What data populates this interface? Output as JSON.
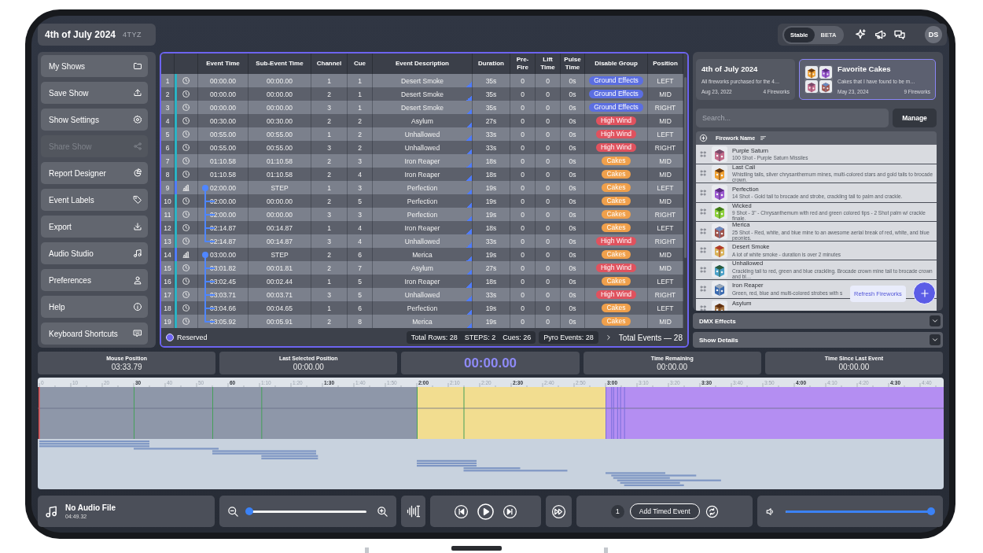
{
  "show": {
    "title": "4th of July 2024",
    "code": "4TYZ"
  },
  "release_toggle": [
    {
      "label": "Stable",
      "selected": true
    },
    {
      "label": "BETA",
      "selected": false
    }
  ],
  "user": {
    "initials": "DS"
  },
  "sidebar": {
    "items": [
      {
        "label": "My Shows",
        "disabled": false
      },
      {
        "label": "Save Show",
        "disabled": false
      },
      {
        "label": "Show Settings",
        "disabled": false
      },
      {
        "label": "Share Show",
        "disabled": true
      },
      {
        "label": "Report Designer",
        "disabled": false
      },
      {
        "label": "Event Labels",
        "disabled": false
      },
      {
        "label": "Export",
        "disabled": false
      },
      {
        "label": "Audio Studio",
        "disabled": false
      },
      {
        "label": "Preferences",
        "disabled": false
      },
      {
        "label": "Help",
        "disabled": false
      },
      {
        "label": "Keyboard Shortcuts",
        "disabled": false
      }
    ]
  },
  "table": {
    "columns": [
      "Event Time",
      "Sub-Event Time",
      "Channel",
      "Cue",
      "Event Description",
      "Duration",
      "Pre-Fire",
      "Lift Time",
      "Pulse Time",
      "Disable Group",
      "Position"
    ],
    "rows": [
      {
        "number": "1",
        "kind": "timed",
        "event_time": "00:00.00",
        "sub_event_time": "00:00.00",
        "channel": "1",
        "cue": "1",
        "description": "Desert Smoke",
        "duration": "35s",
        "pre_fire": "0",
        "lift_time": "0",
        "pulse_time": "0s",
        "disable_group": {
          "label": "Ground Effects",
          "color": "#5b6ee1"
        },
        "position": "LEFT"
      },
      {
        "number": "2",
        "kind": "timed",
        "event_time": "00:00.00",
        "sub_event_time": "00:00.00",
        "channel": "2",
        "cue": "1",
        "description": "Desert Smoke",
        "duration": "35s",
        "pre_fire": "0",
        "lift_time": "0",
        "pulse_time": "0s",
        "disable_group": {
          "label": "Ground Effects",
          "color": "#5b6ee1"
        },
        "position": "MID"
      },
      {
        "number": "3",
        "kind": "timed",
        "event_time": "00:00.00",
        "sub_event_time": "00:00.00",
        "channel": "3",
        "cue": "1",
        "description": "Desert Smoke",
        "duration": "35s",
        "pre_fire": "0",
        "lift_time": "0",
        "pulse_time": "0s",
        "disable_group": {
          "label": "Ground Effects",
          "color": "#5b6ee1"
        },
        "position": "RIGHT"
      },
      {
        "number": "4",
        "kind": "timed",
        "event_time": "00:30.00",
        "sub_event_time": "00:30.00",
        "channel": "2",
        "cue": "2",
        "description": "Asylum",
        "duration": "27s",
        "pre_fire": "0",
        "lift_time": "0",
        "pulse_time": "0s",
        "disable_group": {
          "label": "High Wind",
          "color": "#e0525e"
        },
        "position": "MID"
      },
      {
        "number": "5",
        "kind": "timed",
        "event_time": "00:55.00",
        "sub_event_time": "00:55.00",
        "channel": "1",
        "cue": "2",
        "description": "Unhallowed",
        "duration": "33s",
        "pre_fire": "0",
        "lift_time": "0",
        "pulse_time": "0s",
        "disable_group": {
          "label": "High Wind",
          "color": "#e0525e"
        },
        "position": "LEFT"
      },
      {
        "number": "6",
        "kind": "timed",
        "event_time": "00:55.00",
        "sub_event_time": "00:55.00",
        "channel": "3",
        "cue": "2",
        "description": "Unhallowed",
        "duration": "33s",
        "pre_fire": "0",
        "lift_time": "0",
        "pulse_time": "0s",
        "disable_group": {
          "label": "High Wind",
          "color": "#e0525e"
        },
        "position": "RIGHT"
      },
      {
        "number": "7",
        "kind": "timed",
        "event_time": "01:10.58",
        "sub_event_time": "01:10.58",
        "channel": "2",
        "cue": "3",
        "description": "Iron Reaper",
        "duration": "18s",
        "pre_fire": "0",
        "lift_time": "0",
        "pulse_time": "0s",
        "disable_group": {
          "label": "Cakes",
          "color": "#f0a04b"
        },
        "position": "MID"
      },
      {
        "number": "8",
        "kind": "timed",
        "event_time": "01:10.58",
        "sub_event_time": "01:10.58",
        "channel": "2",
        "cue": "4",
        "description": "Iron Reaper",
        "duration": "18s",
        "pre_fire": "0",
        "lift_time": "0",
        "pulse_time": "0s",
        "disable_group": {
          "label": "Cakes",
          "color": "#f0a04b"
        },
        "position": "MID"
      },
      {
        "number": "9",
        "kind": "step",
        "event_time": "02:00.00",
        "sub_event_time": "STEP",
        "channel": "1",
        "cue": "3",
        "description": "Perfection",
        "duration": "19s",
        "pre_fire": "0",
        "lift_time": "0",
        "pulse_time": "0s",
        "disable_group": {
          "label": "Cakes",
          "color": "#f0a04b"
        },
        "position": "LEFT",
        "children": [
          {
            "number": "10",
            "kind": "timed",
            "event_time": "02:00.00",
            "sub_event_time": "00:00.00",
            "channel": "2",
            "cue": "5",
            "description": "Perfection",
            "duration": "19s",
            "pre_fire": "0",
            "lift_time": "0",
            "pulse_time": "0s",
            "disable_group": {
              "label": "Cakes",
              "color": "#f0a04b"
            },
            "position": "MID"
          },
          {
            "number": "11",
            "kind": "timed",
            "event_time": "02:00.00",
            "sub_event_time": "00:00.00",
            "channel": "3",
            "cue": "3",
            "description": "Perfection",
            "duration": "19s",
            "pre_fire": "0",
            "lift_time": "0",
            "pulse_time": "0s",
            "disable_group": {
              "label": "Cakes",
              "color": "#f0a04b"
            },
            "position": "RIGHT"
          },
          {
            "number": "12",
            "kind": "timed",
            "event_time": "02:14.87",
            "sub_event_time": "00:14.87",
            "channel": "1",
            "cue": "4",
            "description": "Iron Reaper",
            "duration": "18s",
            "pre_fire": "0",
            "lift_time": "0",
            "pulse_time": "0s",
            "disable_group": {
              "label": "Cakes",
              "color": "#f0a04b"
            },
            "position": "LEFT"
          },
          {
            "number": "13",
            "kind": "timed",
            "event_time": "02:14.87",
            "sub_event_time": "00:14.87",
            "channel": "3",
            "cue": "4",
            "description": "Unhallowed",
            "duration": "33s",
            "pre_fire": "0",
            "lift_time": "0",
            "pulse_time": "0s",
            "disable_group": {
              "label": "High Wind",
              "color": "#e0525e"
            },
            "position": "RIGHT"
          }
        ]
      },
      {
        "number": "14",
        "kind": "step",
        "event_time": "03:00.00",
        "sub_event_time": "STEP",
        "channel": "2",
        "cue": "6",
        "description": "Merica",
        "duration": "19s",
        "pre_fire": "0",
        "lift_time": "0",
        "pulse_time": "0s",
        "disable_group": {
          "label": "Cakes",
          "color": "#f0a04b"
        },
        "position": "MID",
        "children": [
          {
            "number": "15",
            "kind": "timed",
            "event_time": "03:01.82",
            "sub_event_time": "00:01.81",
            "channel": "2",
            "cue": "7",
            "description": "Asylum",
            "duration": "27s",
            "pre_fire": "0",
            "lift_time": "0",
            "pulse_time": "0s",
            "disable_group": {
              "label": "High Wind",
              "color": "#e0525e"
            },
            "position": "MID"
          },
          {
            "number": "16",
            "kind": "timed",
            "event_time": "03:02.45",
            "sub_event_time": "00:02.44",
            "channel": "1",
            "cue": "5",
            "description": "Iron Reaper",
            "duration": "18s",
            "pre_fire": "0",
            "lift_time": "0",
            "pulse_time": "0s",
            "disable_group": {
              "label": "Cakes",
              "color": "#f0a04b"
            },
            "position": "LEFT"
          },
          {
            "number": "17",
            "kind": "timed",
            "event_time": "03:03.71",
            "sub_event_time": "00:03.71",
            "channel": "3",
            "cue": "5",
            "description": "Unhallowed",
            "duration": "33s",
            "pre_fire": "0",
            "lift_time": "0",
            "pulse_time": "0s",
            "disable_group": {
              "label": "High Wind",
              "color": "#e0525e"
            },
            "position": "RIGHT"
          },
          {
            "number": "18",
            "kind": "timed",
            "event_time": "03:04.66",
            "sub_event_time": "00:04.65",
            "channel": "1",
            "cue": "6",
            "description": "Perfection",
            "duration": "19s",
            "pre_fire": "0",
            "lift_time": "0",
            "pulse_time": "0s",
            "disable_group": {
              "label": "Cakes",
              "color": "#f0a04b"
            },
            "position": "LEFT"
          },
          {
            "number": "19",
            "kind": "timed",
            "event_time": "03:05.92",
            "sub_event_time": "00:05.91",
            "channel": "2",
            "cue": "8",
            "description": "Merica",
            "duration": "19s",
            "pre_fire": "0",
            "lift_time": "0",
            "pulse_time": "0s",
            "disable_group": {
              "label": "Cakes",
              "color": "#f0a04b"
            },
            "position": "MID"
          }
        ]
      }
    ],
    "footer": {
      "legend": "Reserved",
      "total_rows": "Total Rows: 28",
      "steps": "STEPS: 2",
      "cues": "Cues: 26",
      "pyro_events": "Pyro Events: 28",
      "total_events": "Total Events — 28"
    }
  },
  "library": {
    "cards": [
      {
        "title": "4th of July 2024",
        "description": "All fireworks purchased for the 4…",
        "date": "Aug 23, 2022",
        "count": "4 Fireworks",
        "selected": false
      },
      {
        "title": "Favorite Cakes",
        "description": "Cakes that I have found to be m…",
        "date": "May 23, 2024",
        "count": "9 Fireworks",
        "selected": true
      }
    ],
    "search": {
      "placeholder": "Search..."
    },
    "manage_button": "Manage",
    "column": "Firework Name",
    "items": [
      {
        "name": "Purple Saturn",
        "description": "100 Shot - Purple Saturn Missiles"
      },
      {
        "name": "Last Call",
        "description": "Whistling tails, silver chrysanthemum mines, multi-colored stars and gold tails to brocade crown."
      },
      {
        "name": "Perfection",
        "description": "14 Shot - Gold tail to brocade and strobe, crackling tail to palm and crackle."
      },
      {
        "name": "Wicked",
        "description": "9 Shot - 3\" - Chrysanthemum with red and green colored tips - 2 Shot palm w/ crackle finale."
      },
      {
        "name": "Merica",
        "description": "25 Shot - Red, white, and blue mine to an awesome aerial break of red, white, and blue peonies."
      },
      {
        "name": "Desert Smoke",
        "description": "A lot of white smoke - duration is over 2 minutes"
      },
      {
        "name": "Unhallowed",
        "description": "Crackling tail to red, green and blue crackling. Brocade crown mine tail to brocade crown and bl…"
      },
      {
        "name": "Iron Reaper",
        "description": "Green, red, blue and multi-colored strobes with s"
      },
      {
        "name": "Asylum"
      }
    ],
    "tooltip": "Refresh Fireworks"
  },
  "panels": [
    {
      "title": "DMX Effects",
      "expanded": false
    },
    {
      "title": "Show Details",
      "expanded": false
    }
  ],
  "stats": [
    {
      "kind": "readout",
      "label": "Mouse Position",
      "value": "03:33.79"
    },
    {
      "kind": "readout",
      "label": "Last Selected Position",
      "value": "00:00.00"
    },
    {
      "kind": "clock",
      "value": "00:00.00"
    },
    {
      "kind": "readout",
      "label": "Time Remaining",
      "value": "00:00.00"
    },
    {
      "kind": "readout",
      "label": "Time Since Last Event",
      "value": "00:00.00"
    }
  ],
  "timeline": {
    "ruler": [
      "0",
      "10",
      "20",
      "30",
      "40",
      "50",
      "60",
      "1:10",
      "1:20",
      "1:30",
      "1:40",
      "1:50",
      "2:00",
      "2:10",
      "2:20",
      "2:30",
      "2:40",
      "2:50",
      "3:00",
      "3:10",
      "3:20",
      "3:30",
      "3:40",
      "3:50",
      "4:00",
      "4:10",
      "4:20",
      "4:30",
      "4:40"
    ]
  },
  "controls": {
    "audio": {
      "title": "No Audio File",
      "length": "04:49.32"
    },
    "zoom": {
      "level": 0
    },
    "step_count": "1",
    "add_event": "Add Timed Event",
    "volume": {
      "level": 1
    }
  }
}
